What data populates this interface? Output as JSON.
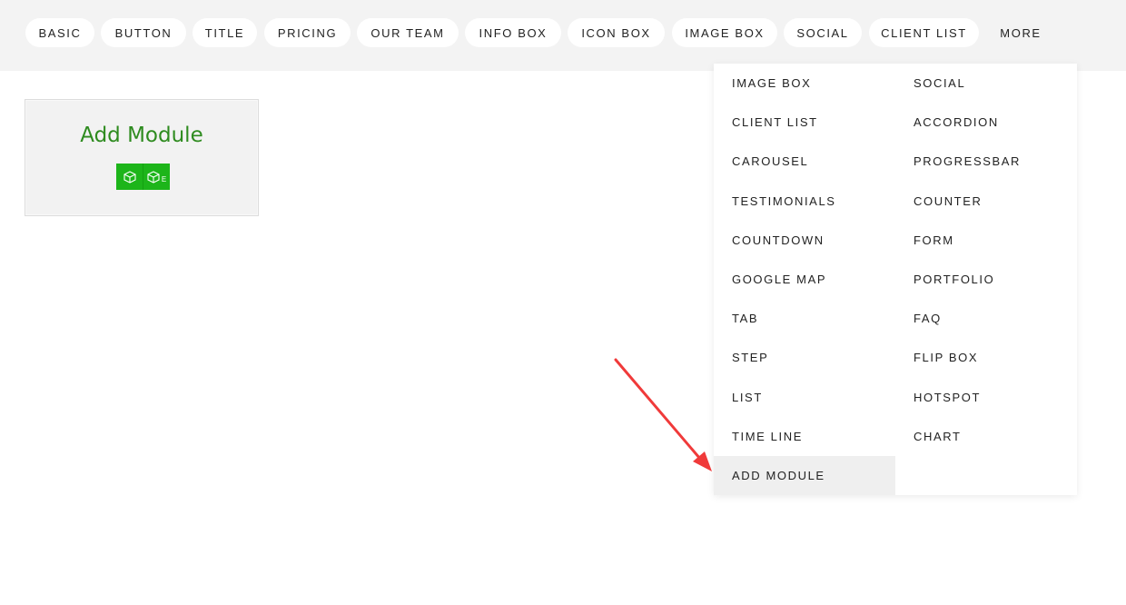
{
  "tabs": [
    "BASIC",
    "BUTTON",
    "TITLE",
    "PRICING",
    "OUR TEAM",
    "INFO BOX",
    "ICON BOX",
    "IMAGE BOX",
    "SOCIAL",
    "CLIENT LIST"
  ],
  "more_label": "MORE",
  "module_card": {
    "title": "Add Module",
    "icons": [
      "cube-icon",
      "cube-edit-icon"
    ],
    "edit_badge": "E",
    "title_color": "#2e8b1f",
    "button_color": "#1db51a"
  },
  "dropdown": {
    "left_column": [
      "IMAGE BOX",
      "CLIENT LIST",
      "CAROUSEL",
      "TESTIMONIALS",
      "COUNTDOWN",
      "GOOGLE MAP",
      "TAB",
      "STEP",
      "LIST",
      "TIME LINE",
      "ADD MODULE"
    ],
    "right_column": [
      "SOCIAL",
      "ACCORDION",
      "PROGRESSBAR",
      "COUNTER",
      "FORM",
      "PORTFOLIO",
      "FAQ",
      "FLIP BOX",
      "HOTSPOT",
      "CHART"
    ],
    "highlighted": "ADD MODULE"
  },
  "annotation": {
    "arrow_color": "#f03a3a",
    "points_to": "ADD MODULE"
  }
}
